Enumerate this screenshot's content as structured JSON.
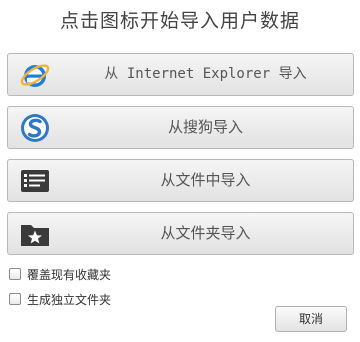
{
  "dialog": {
    "title": "点击图标开始导入用户数据"
  },
  "import_buttons": [
    {
      "label": "从 Internet Explorer 导入",
      "icon": "internet-explorer-icon"
    },
    {
      "label": "从搜狗导入",
      "icon": "sogou-browser-icon"
    },
    {
      "label": "从文件中导入",
      "icon": "file-list-icon"
    },
    {
      "label": "从文件夹导入",
      "icon": "star-folder-icon"
    }
  ],
  "options": [
    {
      "label": "覆盖现有收藏夹",
      "checked": false
    },
    {
      "label": "生成独立文件夹",
      "checked": false
    }
  ],
  "footer": {
    "cancel_label": "取消"
  },
  "colors": {
    "button_border": "#b9b9b9",
    "button_gradient_top": "#f5f5f5",
    "button_gradient_bottom": "#e2e2e2",
    "ie_blue": "#1f7fd6",
    "ie_ring": "#f2b33d",
    "sogou_blue": "#2f78c6",
    "dark_icon": "#3a3a3a"
  }
}
